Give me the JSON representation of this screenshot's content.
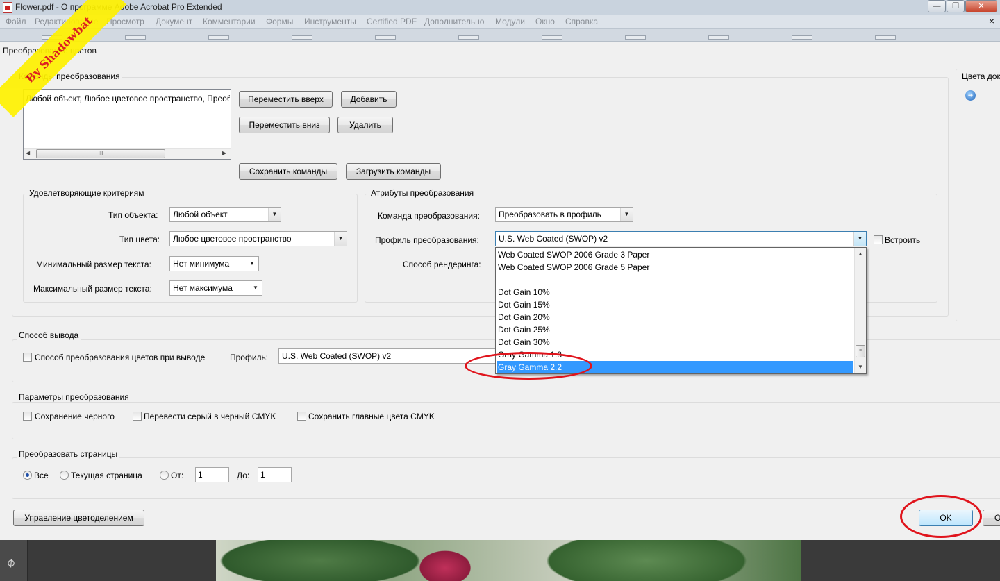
{
  "window": {
    "title": "Flower.pdf - О программе Adobe Acrobat Pro Extended",
    "controls": {
      "minimize": "—",
      "restore": "❐",
      "close": "✕"
    }
  },
  "menu": [
    "Файл",
    "Редактирование",
    "Просмотр",
    "Документ",
    "Комментарии",
    "Формы",
    "Инструменты",
    "Certified PDF",
    "Дополнительно",
    "Модули",
    "Окно",
    "Справка"
  ],
  "menu_close": "×",
  "watermark": "By Shadowbat",
  "dialog": {
    "title": "Преобразование цветов",
    "commands": {
      "label": "Команды преобразования",
      "list_item": "Любой объект, Любое цветовое пространство, Преобразовать в профиль",
      "scroll_thumb": "III",
      "move_up": "Переместить вверх",
      "add": "Добавить",
      "move_down": "Переместить вниз",
      "delete": "Удалить",
      "save": "Сохранить команды",
      "load": "Загрузить команды"
    },
    "criteria": {
      "label": "Удовлетворяющие критериям",
      "object_type_label": "Тип объекта:",
      "object_type_value": "Любой объект",
      "color_type_label": "Тип цвета:",
      "color_type_value": "Любое цветовое пространство",
      "min_text_label": "Минимальный размер текста:",
      "min_text_value": "Нет минимума",
      "max_text_label": "Максимальный размер текста:",
      "max_text_value": "Нет максимума"
    },
    "attributes": {
      "label": "Атрибуты преобразования",
      "command_label": "Команда преобразования:",
      "command_value": "Преобразовать в профиль",
      "profile_label": "Профиль преобразования:",
      "profile_value": "U.S. Web Coated (SWOP) v2",
      "embed_label": "Встроить",
      "render_label": "Способ рендеринга:"
    },
    "dropdown_options": [
      "Web Coated SWOP 2006 Grade 3 Paper",
      "Web Coated SWOP 2006 Grade 5 Paper",
      "",
      "Dot Gain 10%",
      "Dot Gain 15%",
      "Dot Gain 20%",
      "Dot Gain 25%",
      "Dot Gain 30%",
      "Gray Gamma 1.8",
      "Gray Gamma 2.2"
    ],
    "dropdown_selected": "Gray Gamma 2.2",
    "doc_colors": {
      "label": "Цвета доку"
    },
    "output": {
      "label": "Способ вывода",
      "checkbox_label": "Способ преобразования цветов при выводе",
      "profile_label": "Профиль:",
      "profile_value": "U.S. Web Coated (SWOP) v2"
    },
    "params": {
      "label": "Параметры преобразования",
      "keep_black": "Сохранение черного",
      "gray_to_black": "Перевести серый в черный CMYK",
      "keep_primaries": "Сохранить главные цвета CMYK"
    },
    "pages": {
      "label": "Преобразовать страницы",
      "all": "Все",
      "current": "Текущая страница",
      "from_label": "От:",
      "from_value": "1",
      "to_label": "До:",
      "to_value": "1"
    },
    "manage_separations": "Управление цветоделением",
    "ok": "OK",
    "cancel_partial": "О"
  },
  "colors": {
    "selection": "#3399ff",
    "annotation": "#e0141c",
    "watermark_bg": "#fff200"
  }
}
